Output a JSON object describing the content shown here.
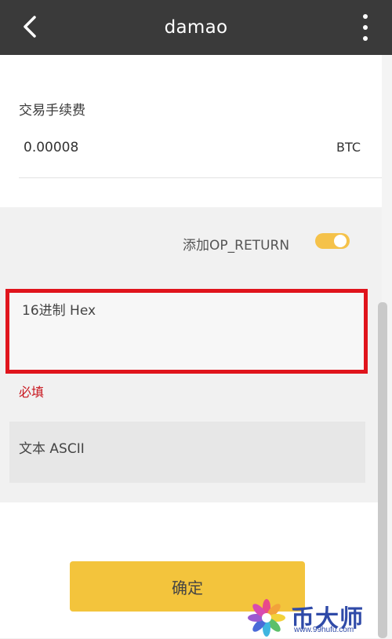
{
  "header": {
    "title": "damao"
  },
  "fee": {
    "label": "交易手续费",
    "value": "0.00008",
    "unit": "BTC"
  },
  "op_return": {
    "label": "添加OP_RETURN",
    "enabled": true
  },
  "hex_field": {
    "label": "16进制 Hex",
    "error": "必填"
  },
  "ascii_field": {
    "label": "文本 ASCII"
  },
  "confirm": {
    "label": "确定"
  },
  "colors": {
    "header_bg": "#3a3a3a",
    "accent": "#f3c43c",
    "error_red": "#c8141c",
    "highlight_border": "#e0141c",
    "watermark_blue": "#2f4aa8"
  },
  "watermark": {
    "title": "币大师",
    "url": "www.99hufu.com",
    "icon": "flower-logo-icon"
  },
  "icons": {
    "back": "chevron-left-icon",
    "menu": "more-vertical-icon"
  }
}
